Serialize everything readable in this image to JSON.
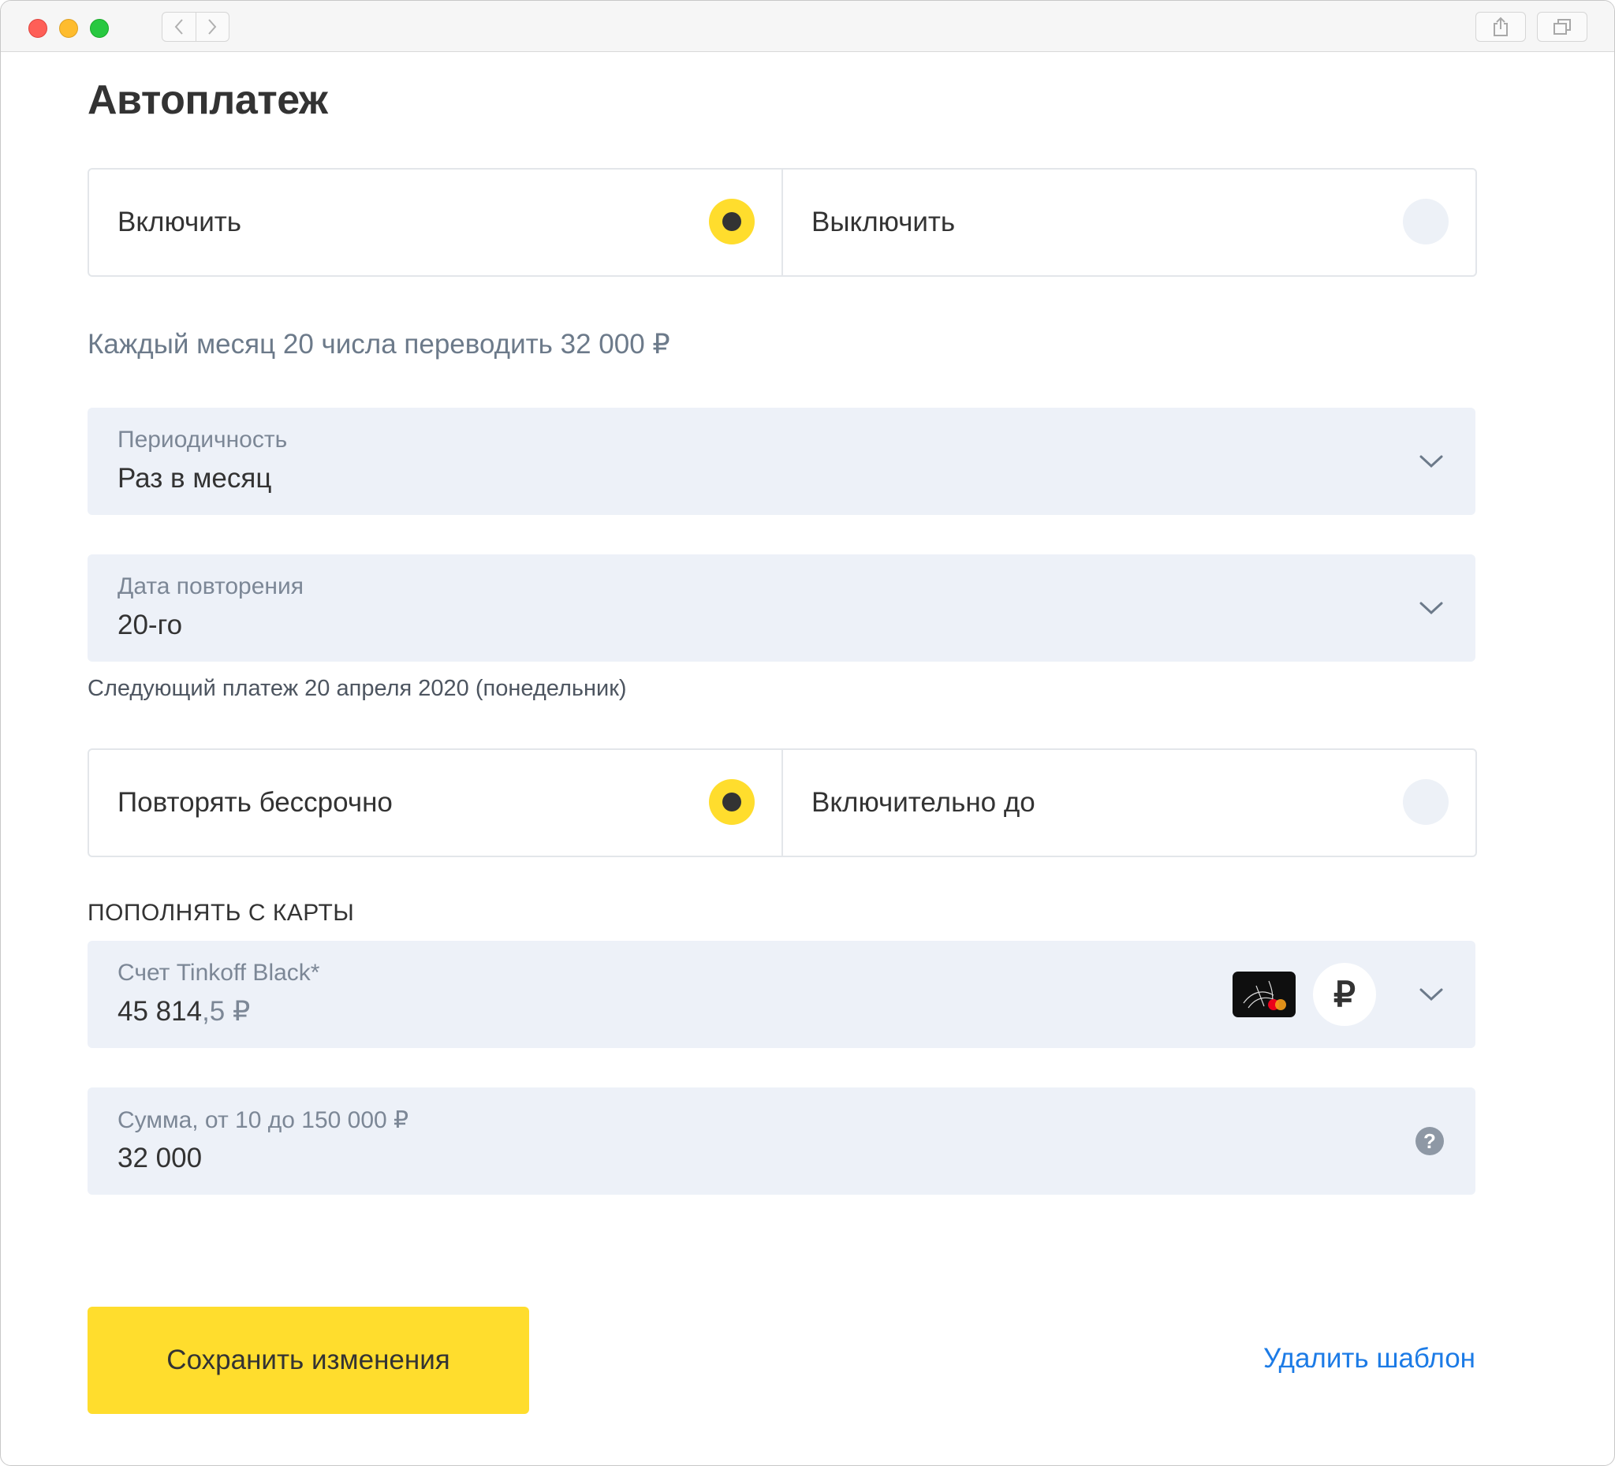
{
  "page": {
    "title": "Автоплатеж"
  },
  "toggle_enable": {
    "on_label": "Включить",
    "off_label": "Выключить",
    "selected": "on"
  },
  "summary": "Каждый месяц 20 числа переводить 32 000 ₽",
  "periodicity": {
    "label": "Периодичность",
    "value": "Раз в месяц"
  },
  "repeat_date": {
    "label": "Дата повторения",
    "value": "20-го"
  },
  "next_payment": "Следующий платеж 20 апреля 2020 (понедельник)",
  "repeat_mode": {
    "forever_label": "Повторять бессрочно",
    "until_label": "Включительно до",
    "selected": "forever"
  },
  "source": {
    "section_title": "ПОПОЛНЯТЬ С КАРТЫ",
    "account_label": "Счет Tinkoff Black*",
    "balance_main": "45 814",
    "balance_frac": ",5 ₽",
    "currency_symbol": "₽"
  },
  "amount": {
    "label": "Сумма, от 10 до 150 000 ₽",
    "value": "32 000"
  },
  "actions": {
    "save_label": "Сохранить изменения",
    "delete_label": "Удалить шаблон"
  },
  "colors": {
    "accent": "#ffdd2d",
    "link": "#1c7be6",
    "field_bg": "#edf1f8"
  }
}
